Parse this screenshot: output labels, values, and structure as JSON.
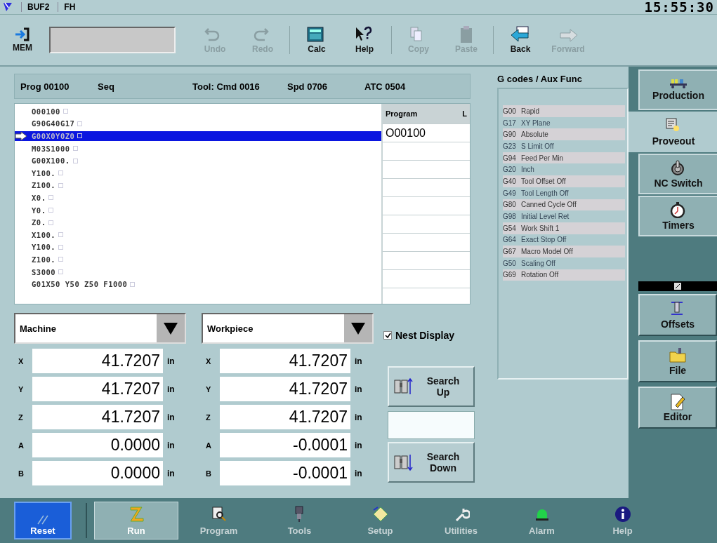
{
  "status_bar": {
    "items": [
      "BUF2",
      "FH"
    ],
    "time": "15:55:30"
  },
  "toolbar": {
    "mode": "MEM",
    "buttons": [
      {
        "label": "Undo",
        "kind": "undo",
        "disabled": true
      },
      {
        "label": "Redo",
        "kind": "redo",
        "disabled": true
      },
      {
        "label": "Calc",
        "kind": "calc",
        "disabled": false
      },
      {
        "label": "Help",
        "kind": "help",
        "disabled": false
      },
      {
        "label": "Copy",
        "kind": "copy",
        "disabled": true
      },
      {
        "label": "Paste",
        "kind": "paste",
        "disabled": true
      },
      {
        "label": "Back",
        "kind": "back",
        "disabled": false
      },
      {
        "label": "Forward",
        "kind": "forward",
        "disabled": true
      }
    ]
  },
  "header": [
    "Prog 00100",
    "Seq",
    "Tool: Cmd 0016",
    "Spd 0706",
    "ATC 0504"
  ],
  "program_lines": [
    {
      "text": "O00100",
      "selected": false
    },
    {
      "text": "G90G40G17",
      "selected": false
    },
    {
      "text": "G00X0Y0Z0",
      "selected": true
    },
    {
      "text": "M03S1000",
      "selected": false
    },
    {
      "text": "G00X100.",
      "selected": false
    },
    {
      "text": "Y100.",
      "selected": false
    },
    {
      "text": "Z100.",
      "selected": false
    },
    {
      "text": "X0.",
      "selected": false
    },
    {
      "text": "Y0.",
      "selected": false
    },
    {
      "text": "Z0.",
      "selected": false
    },
    {
      "text": "X100.",
      "selected": false
    },
    {
      "text": "Y100.",
      "selected": false
    },
    {
      "text": "Z100.",
      "selected": false
    },
    {
      "text": "S3000",
      "selected": false
    },
    {
      "text": "G01X50 Y50 Z50 F1000",
      "selected": false
    }
  ],
  "program_table": {
    "columns": [
      "Program",
      "L"
    ],
    "rows": [
      "O00100"
    ]
  },
  "gcodes": {
    "title": "G codes / Aux Func",
    "items": [
      {
        "code": "G00",
        "name": "Rapid"
      },
      {
        "code": "G17",
        "name": "XY Plane"
      },
      {
        "code": "G90",
        "name": "Absolute"
      },
      {
        "code": "G23",
        "name": "S Limit Off"
      },
      {
        "code": "G94",
        "name": "Feed Per Min"
      },
      {
        "code": "G20",
        "name": "Inch"
      },
      {
        "code": "G40",
        "name": "Tool Offset Off"
      },
      {
        "code": "G49",
        "name": "Tool Length Off"
      },
      {
        "code": "G80",
        "name": "Canned Cycle Off"
      },
      {
        "code": "G98",
        "name": "Initial Level Ret"
      },
      {
        "code": "G54",
        "name": "Work Shift 1"
      },
      {
        "code": "G64",
        "name": "Exact Stop Off"
      },
      {
        "code": "G67",
        "name": "Macro Model Off"
      },
      {
        "code": "G50",
        "name": "Scaling Off"
      },
      {
        "code": "G69",
        "name": "Rotation Off"
      }
    ]
  },
  "positions": [
    {
      "frame": "Machine",
      "axes": [
        {
          "axis": "X",
          "value": "41.7207",
          "unit": "in"
        },
        {
          "axis": "Y",
          "value": "41.7207",
          "unit": "in"
        },
        {
          "axis": "Z",
          "value": "41.7207",
          "unit": "in"
        },
        {
          "axis": "A",
          "value": "0.0000",
          "unit": "in"
        },
        {
          "axis": "B",
          "value": "0.0000",
          "unit": "in"
        }
      ]
    },
    {
      "frame": "Workpiece",
      "axes": [
        {
          "axis": "X",
          "value": "41.7207",
          "unit": "in"
        },
        {
          "axis": "Y",
          "value": "41.7207",
          "unit": "in"
        },
        {
          "axis": "Z",
          "value": "41.7207",
          "unit": "in"
        },
        {
          "axis": "A",
          "value": "-0.0001",
          "unit": "in"
        },
        {
          "axis": "B",
          "value": "-0.0001",
          "unit": "in"
        }
      ]
    }
  ],
  "nest_display": {
    "label": "Nest Display",
    "checked": true
  },
  "search": {
    "up": "Search\nUp",
    "down": "Search\nDown"
  },
  "side_tabs": [
    {
      "label": "Production",
      "kind": "production",
      "selected": false
    },
    {
      "label": "Proveout",
      "kind": "proveout",
      "selected": true
    },
    {
      "label": "NC Switch",
      "kind": "switch",
      "selected": false
    },
    {
      "label": "Timers",
      "kind": "timers",
      "selected": false
    }
  ],
  "side_buttons": [
    {
      "label": "Offsets",
      "kind": "offsets"
    },
    {
      "label": "File",
      "kind": "file"
    },
    {
      "label": "Editor",
      "kind": "editor"
    }
  ],
  "bottom_bar": {
    "reset": "Reset",
    "tabs": [
      {
        "label": "Run",
        "kind": "run",
        "selected": true
      },
      {
        "label": "Program",
        "kind": "program",
        "selected": false
      },
      {
        "label": "Tools",
        "kind": "tools",
        "selected": false
      },
      {
        "label": "Setup",
        "kind": "setup",
        "selected": false
      },
      {
        "label": "Utilities",
        "kind": "utilities",
        "selected": false
      },
      {
        "label": "Alarm",
        "kind": "alarm",
        "selected": false
      },
      {
        "label": "Help",
        "kind": "help",
        "selected": false
      }
    ]
  }
}
